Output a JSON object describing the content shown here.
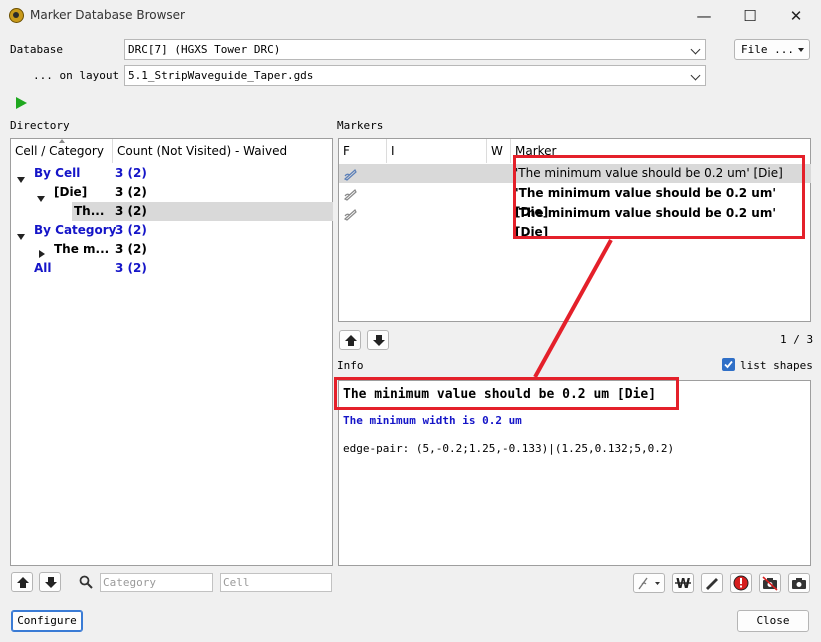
{
  "window": {
    "title": "Marker Database Browser",
    "minimize": "—",
    "maximize": "☐",
    "close": "✕"
  },
  "database": {
    "label": "Database",
    "value": "DRC[7] (HGXS Tower DRC)",
    "file_button": "File ..."
  },
  "layout": {
    "label": "... on layout",
    "value": "5.1_StripWaveguide_Taper.gds"
  },
  "directory": {
    "label": "Directory",
    "columns": [
      "Cell / Category",
      "Count (Not Visited) - Waived"
    ],
    "rows": [
      {
        "name": "By Cell",
        "count": "3 (2)"
      },
      {
        "name": "[Die]",
        "count": "3 (2)"
      },
      {
        "name": "Th...",
        "count": "3 (2)"
      },
      {
        "name": "By Category",
        "count": "3 (2)"
      },
      {
        "name": "The m...",
        "count": "3 (2)"
      },
      {
        "name": "All",
        "count": "3 (2)"
      }
    ],
    "category_placeholder": "Category",
    "cell_placeholder": "Cell"
  },
  "markers": {
    "label": "Markers",
    "columns": [
      "F",
      "I",
      "W",
      "Marker"
    ],
    "rows": [
      {
        "text": "'The minimum value should be 0.2 um' [Die]"
      },
      {
        "text": "'The minimum value should be 0.2 um' [Die]"
      },
      {
        "text": "'The minimum value should be 0.2 um' [Die]"
      }
    ],
    "page": "1 / 3"
  },
  "info": {
    "label": "Info",
    "list_shapes": "list shapes",
    "list_shapes_checked": true,
    "title": "The minimum value should be 0.2 um [Die]",
    "subtitle": "The minimum width is 0.2 um",
    "detail": "edge-pair: (5,-0.2;1.25,-0.133)|(1.25,0.132;5,0.2)"
  },
  "footer": {
    "configure": "Configure",
    "close": "Close"
  },
  "colors": {
    "accent_blue": "#1515c8",
    "highlight_red": "#e4202a",
    "play_green": "#1fa81f"
  }
}
